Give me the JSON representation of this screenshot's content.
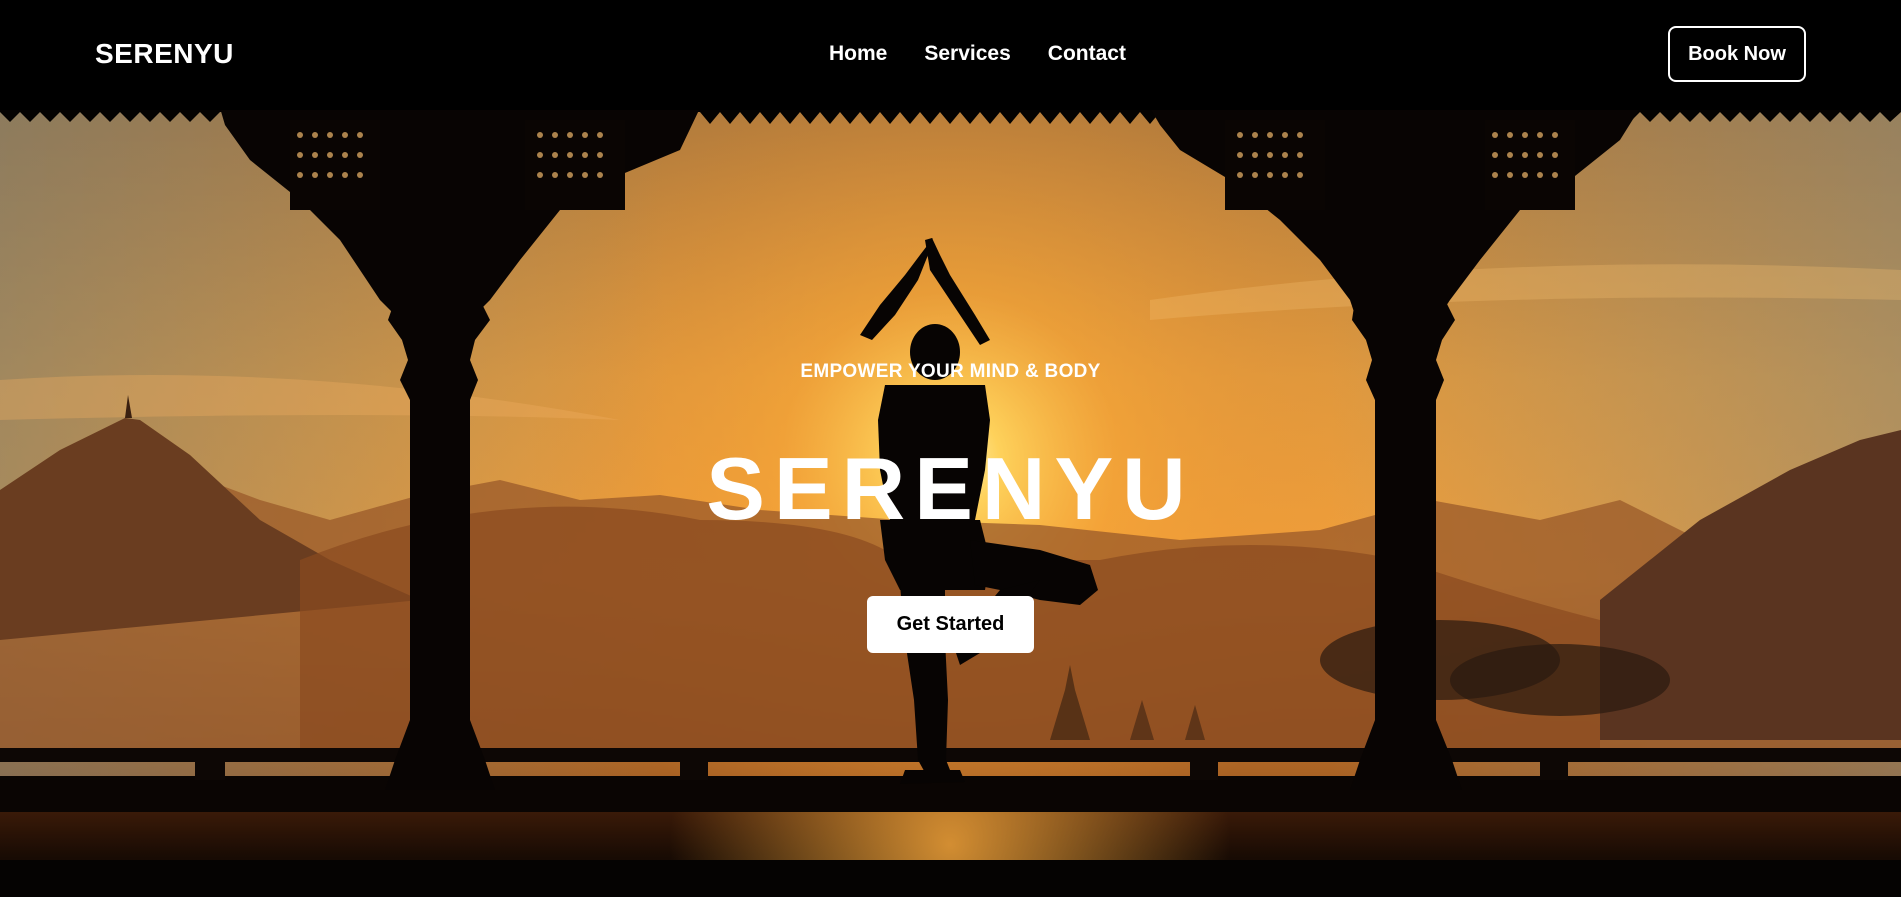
{
  "navbar": {
    "brand": "SERENYU",
    "links": [
      {
        "label": "Home"
      },
      {
        "label": "Services"
      },
      {
        "label": "Contact"
      }
    ],
    "book_label": "Book Now"
  },
  "hero": {
    "tagline": "EMPOWER YOUR MIND & BODY",
    "title": "SERENYU",
    "cta_label": "Get Started"
  },
  "colors": {
    "background": "#000000",
    "sky_top": "#c98a3a",
    "sun_glow": "#ffd56a",
    "sunset_orange": "#f5a63a",
    "silhouette": "#0a0604",
    "button_bg": "#ffffff",
    "text": "#ffffff"
  }
}
